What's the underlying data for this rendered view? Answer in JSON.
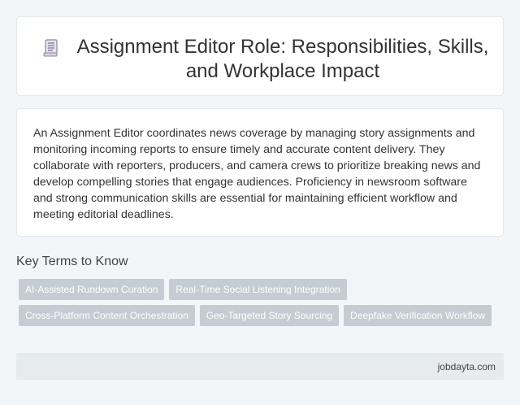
{
  "header": {
    "icon": "document-icon",
    "title": "Assignment Editor Role: Responsibilities, Skills, and Workplace Impact"
  },
  "description": {
    "text": "An Assignment Editor coordinates news coverage by managing story assignments and monitoring incoming reports to ensure timely and accurate content delivery. They collaborate with reporters, producers, and camera crews to prioritize breaking news and develop compelling stories that engage audiences. Proficiency in newsroom software and strong communication skills are essential for maintaining efficient workflow and meeting editorial deadlines."
  },
  "key_terms": {
    "heading": "Key Terms to Know",
    "tags": [
      "AI-Assisted Rundown Curation",
      "Real-Time Social Listening Integration",
      "Cross-Platform Content Orchestration",
      "Geo-Targeted Story Sourcing",
      "Deepfake Verification Workflow"
    ]
  },
  "footer": {
    "site": "jobdayta.com"
  },
  "colors": {
    "background": "#f3f6f8",
    "tag_background": "#c5ccd3",
    "footer_background": "#e6eceb"
  }
}
